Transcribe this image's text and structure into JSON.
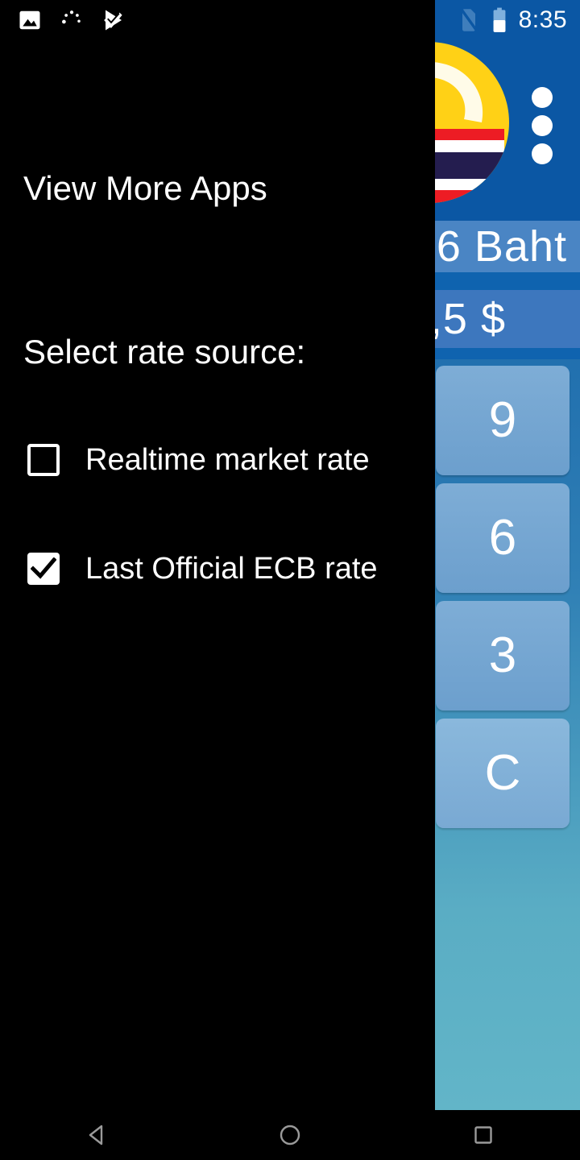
{
  "status_bar": {
    "left_icons": [
      {
        "name": "image-icon",
        "label": "Image downloaded"
      },
      {
        "name": "loading-dots-icon",
        "label": "Syncing"
      },
      {
        "name": "play-store-check-icon",
        "label": "App installed"
      }
    ],
    "no_sim_icon": "no-sim-icon",
    "battery_icon": "battery-icon",
    "time": "8:35"
  },
  "drawer": {
    "title": "View More Apps",
    "section_label": "Select rate source:",
    "options": [
      {
        "label": "Realtime market rate",
        "checked": false
      },
      {
        "label": "Last Official ECB rate",
        "checked": true
      }
    ]
  },
  "app": {
    "logo_name": "thai-baht-converter-logo",
    "overflow_menu_name": "overflow-menu-icon",
    "result_text": "6 Baht",
    "input_text": ",5 $",
    "keys": [
      {
        "label": "9"
      },
      {
        "label": "6"
      },
      {
        "label": "3"
      },
      {
        "label": "C"
      }
    ]
  },
  "nav_bar": {
    "back": "back-button",
    "home": "home-button",
    "recents": "recents-button"
  },
  "colors": {
    "app_bar_blue": "#0b57a4",
    "result_row_blue": "#4a85c4",
    "input_row_blue": "#3d77be",
    "key_blue": "#7eadd6",
    "gradient_bottom_teal": "#62b5c8",
    "drawer_black": "#000000",
    "logo_yellow": "#ffd116"
  }
}
